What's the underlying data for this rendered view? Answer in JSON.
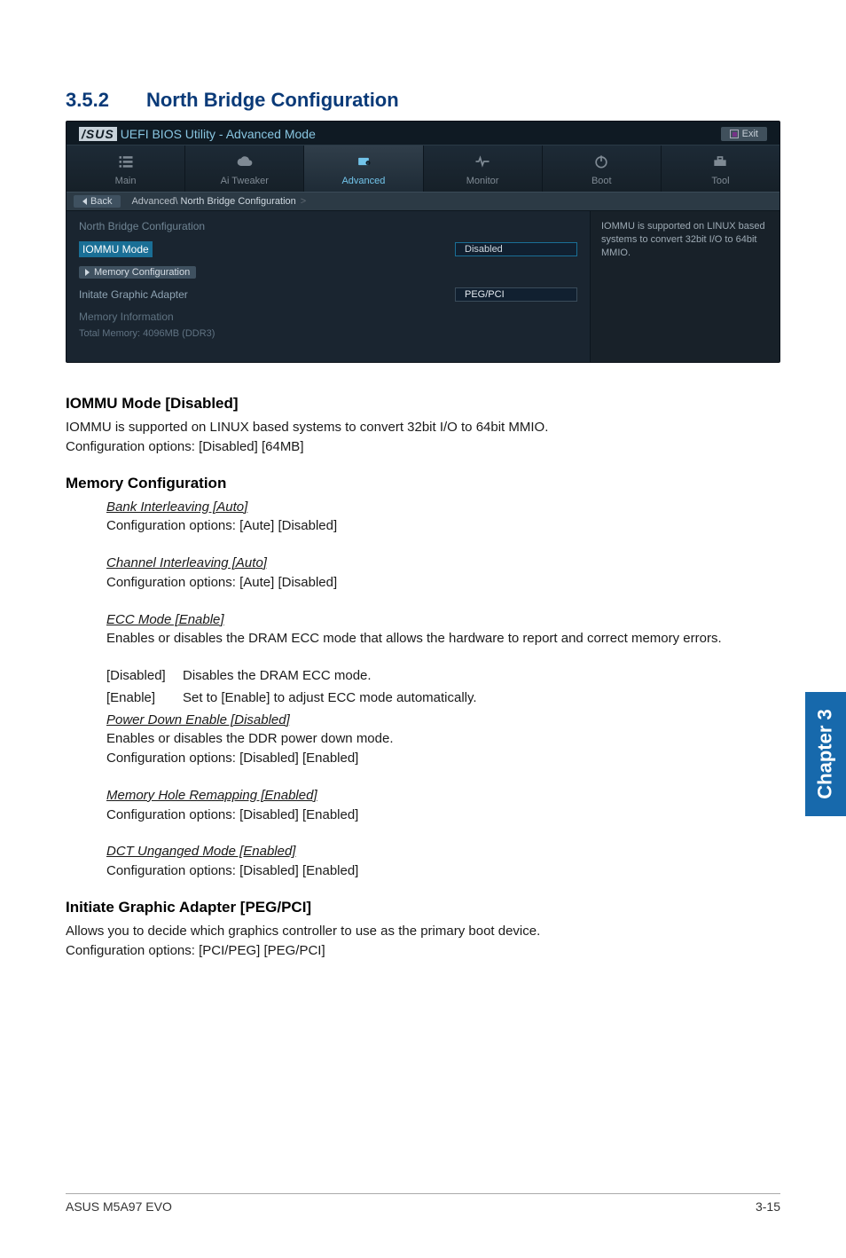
{
  "section": {
    "number": "3.5.2",
    "title": "North Bridge Configuration"
  },
  "bios": {
    "brand_prefix": "/SUS",
    "window_title": "UEFI BIOS Utility - Advanced Mode",
    "exit_label": "Exit",
    "tabs": {
      "main": "Main",
      "tweaker": "Ai Tweaker",
      "advanced": "Advanced",
      "monitor": "Monitor",
      "boot": "Boot",
      "tool": "Tool"
    },
    "breadcrumb": {
      "back": "Back",
      "path1": "Advanced\\",
      "path2": "North Bridge Configuration",
      "sep": ">"
    },
    "panel_title": "North Bridge Configuration",
    "iommu_label": "IOMMU Mode",
    "iommu_value": "Disabled",
    "memory_config": "Memory Configuration",
    "initiate": "Initate Graphic Adapter",
    "initiate_value": "PEG/PCI",
    "mem_info": "Memory Information",
    "total": "Total Memory: 4096MB (DDR3)",
    "help": "IOMMU is supported on LINUX based systems to convert 32bit I/O to 64bit MMIO."
  },
  "iommu": {
    "heading": "IOMMU Mode [Disabled]",
    "line1": "IOMMU is supported on LINUX based systems to convert 32bit I/O to 64bit MMIO.",
    "line2": "Configuration options: [Disabled] [64MB]"
  },
  "memconf": {
    "heading": "Memory Configuration",
    "bank_t": "Bank Interleaving [Auto]",
    "bank_b": "Configuration options: [Aute] [Disabled]",
    "chan_t": "Channel Interleaving [Auto]",
    "chan_b": "Configuration options: [Aute] [Disabled]",
    "ecc_t": "ECC Mode [Enable]",
    "ecc_b": "Enables or disables the DRAM ECC mode that allows the hardware to report and correct memory errors.",
    "opt1_k": "[Disabled]",
    "opt1_v": "Disables the DRAM ECC mode.",
    "opt2_k": "[Enable]",
    "opt2_v": "Set to [Enable] to adjust ECC mode automatically.",
    "pd_t": "Power Down Enable [Disabled]",
    "pd_b1": "Enables or disables the DDR power down mode.",
    "pd_b2": "Configuration options: [Disabled] [Enabled]",
    "hole_t": "Memory Hole Remapping [Enabled]",
    "hole_b": "Configuration options: [Disabled] [Enabled]",
    "dct_t": "DCT Unganged Mode [Enabled]",
    "dct_b": "Configuration options: [Disabled] [Enabled]"
  },
  "initiate": {
    "heading": "Initiate Graphic Adapter [PEG/PCI]",
    "line1": "Allows you to decide which graphics controller to use as the primary boot device.",
    "line2": "Configuration options: [PCI/PEG] [PEG/PCI]"
  },
  "chapter": "Chapter 3",
  "footer": {
    "left": "ASUS M5A97 EVO",
    "right": "3-15"
  }
}
